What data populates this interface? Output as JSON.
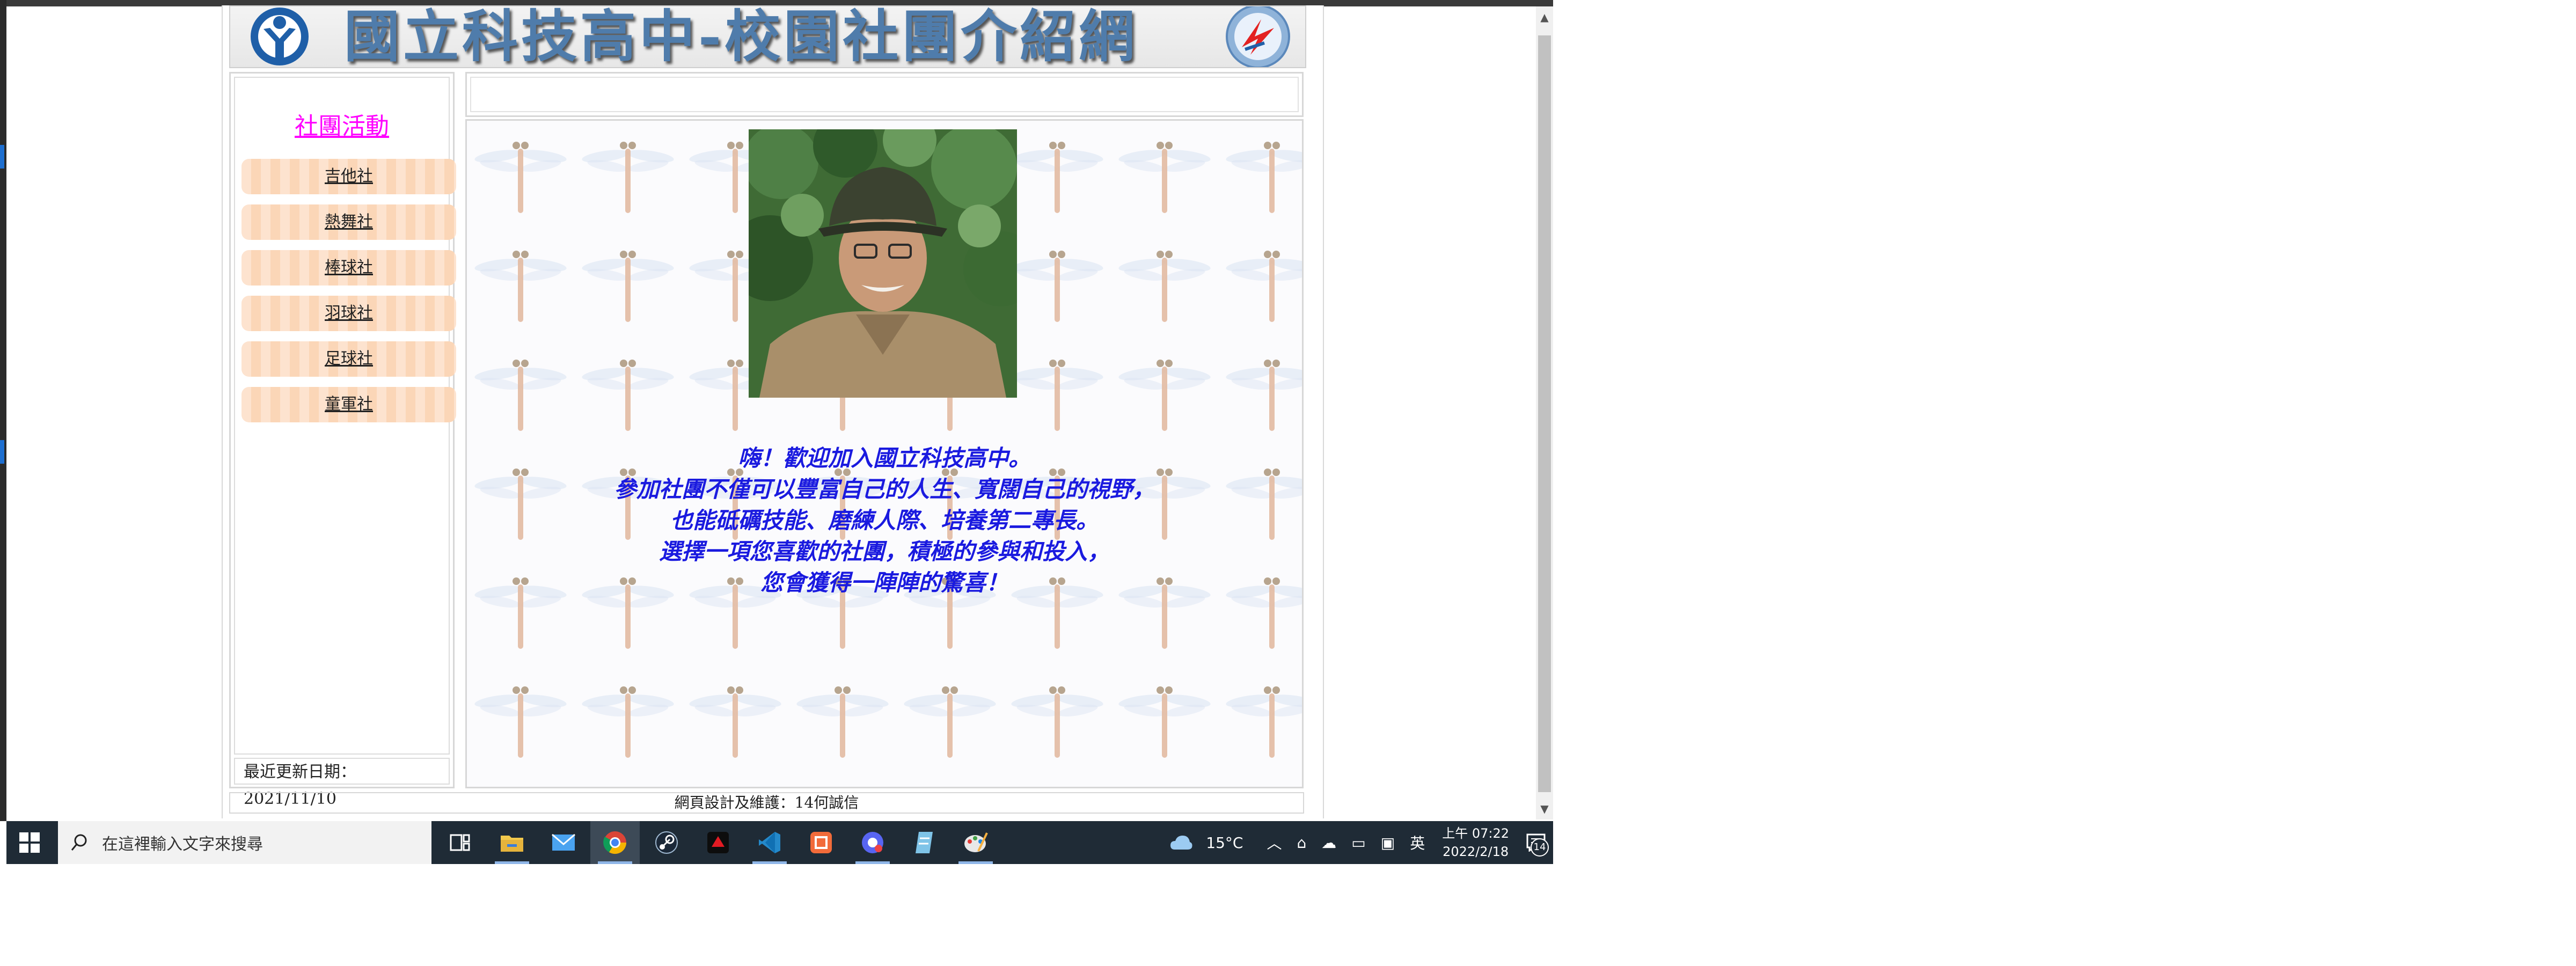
{
  "banner": {
    "title": "國立科技高中-校園社團介紹網"
  },
  "sidebar": {
    "title": "社團活動",
    "clubs": [
      "吉他社",
      "熱舞社",
      "棒球社",
      "羽球社",
      "足球社",
      "童軍社"
    ],
    "update_date": "最近更新日期：2021/11/10"
  },
  "content": {
    "welcome_lines": [
      "嗨！歡迎加入國立科技高中。",
      "參加社團不僅可以豐富自己的人生、寬闊自己的視野，",
      "也能砥礪技能、磨練人際、培養第二專長。",
      "選擇一項您喜歡的社團，積極的參與和投入，",
      "您會獲得一陣陣的驚喜！"
    ]
  },
  "footer": {
    "text": "網頁設計及維護：14何誠信"
  },
  "taskbar": {
    "search_placeholder": "在這裡輸入文字來搜尋",
    "weather": "15°C",
    "ime": "英",
    "clock_time": "上午 07:22",
    "clock_date": "2022/2/18",
    "notification_count": "14",
    "apps": [
      "task-view-icon",
      "file-explorer-icon",
      "mail-icon",
      "chrome-icon",
      "steam-icon",
      "app-red-icon",
      "vscode-icon",
      "app-orange-icon",
      "app-purple-icon",
      "notepad-icon",
      "paint-icon"
    ]
  }
}
